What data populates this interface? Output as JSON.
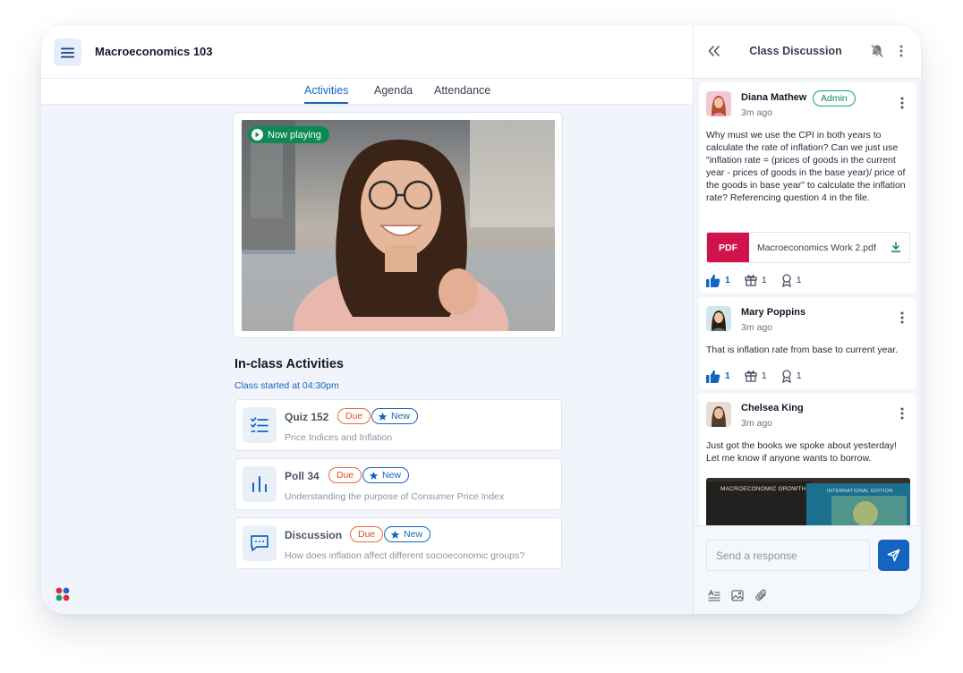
{
  "app": {
    "title": "Macroeconomics 103"
  },
  "tabs": [
    {
      "label": "Activities",
      "active": true
    },
    {
      "label": "Agenda",
      "active": false
    },
    {
      "label": "Attendance",
      "active": false
    }
  ],
  "video": {
    "status_label": "Now playing"
  },
  "activities_section": {
    "title": "In-class Activities",
    "subtitle": "Class started at 04:30pm",
    "items": [
      {
        "title": "Quiz 152",
        "due_label": "Due",
        "new_label": "New",
        "description": "Price Indices and Inflation",
        "icon": "checklist-icon"
      },
      {
        "title": "Poll 34",
        "due_label": "Due",
        "new_label": "New",
        "description": "Understanding the purpose of Consumer Price Index",
        "icon": "bar-chart-icon"
      },
      {
        "title": "Discussion",
        "due_label": "Due",
        "new_label": "New",
        "description": "How does inflation affect different socioeconomic groups?",
        "icon": "chat-bubble-icon"
      }
    ]
  },
  "discussion": {
    "title": "Class Discussion",
    "messages": [
      {
        "author": "Diana Mathew",
        "role_badge": "Admin",
        "time": "3m ago",
        "body": "Why must we use the CPI in both years to calculate the rate of inflation? Can we just use \"inflation rate = (prices of goods in the current year - prices of goods in the base year)/ price of the goods in base year\" to calculate the inflation rate? Referencing question 4 in the file.",
        "attachment": {
          "type_label": "PDF",
          "file_name": "Macroeconomics Work 2.pdf"
        },
        "reactions": {
          "likes": "1",
          "gifts": "1",
          "awards": "1"
        }
      },
      {
        "author": "Mary Poppins",
        "time": "3m ago",
        "body": "That is inflation rate from base to current year.",
        "reactions": {
          "likes": "1",
          "gifts": "1",
          "awards": "1"
        }
      },
      {
        "author": "Chelsea King",
        "time": "3m ago",
        "body": "Just got the books we spoke about yesterday! Let me know if anyone wants to borrow.",
        "image_text": {
          "book1": "MACROECONOMIC GROWTH",
          "book2": "INTERNATIONAL EDITION"
        }
      }
    ],
    "composer": {
      "placeholder": "Send a response"
    }
  },
  "colors": {
    "accent": "#1565c0",
    "success": "#0b8a54",
    "due": "#d9531e",
    "pdf": "#d0134a"
  }
}
